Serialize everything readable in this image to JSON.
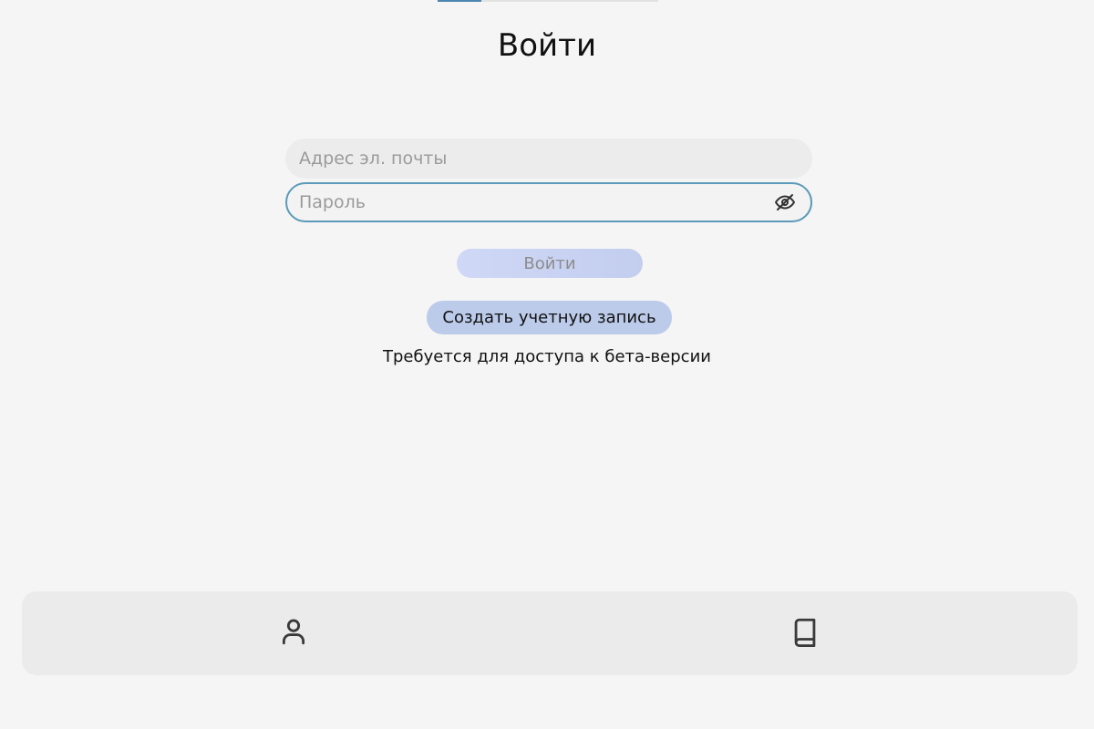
{
  "page": {
    "title": "Войти",
    "progress_fraction": 0.2
  },
  "form": {
    "email": {
      "placeholder": "Адрес эл. почты",
      "value": ""
    },
    "password": {
      "placeholder": "Пароль",
      "value": "",
      "toggle_icon": "eye-off-icon"
    },
    "login_button_label": "Войти",
    "create_account_label": "Создать учетную запись",
    "beta_note": "Требуется для доступа к бета-версии"
  },
  "bottom_nav": {
    "items": [
      {
        "icon": "user-icon"
      },
      {
        "icon": "book-icon"
      }
    ]
  },
  "colors": {
    "accent": "#5b9ab8",
    "button_bg": "#bccbea",
    "background": "#f5f5f5"
  }
}
